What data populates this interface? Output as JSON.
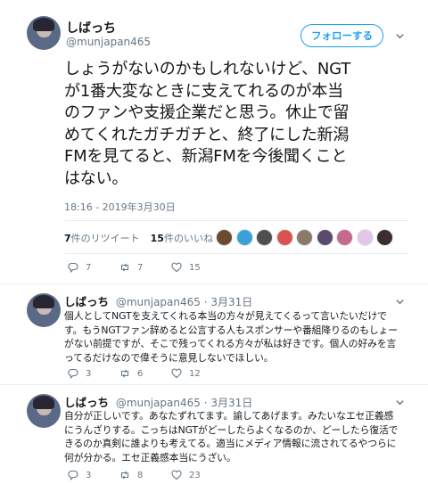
{
  "tweet": {
    "name": "しばっち",
    "handle": "@munjapan465",
    "follow_label": "フォローする",
    "text_lines": [
      "しょうがないのかもしれないけど、NGT",
      "が1番大変なときに支えてれるのが本当",
      "のファンや支援企業だと思う。休止で留",
      "めてくれたガチガチと、終了にした新潟",
      "FMを見てると、新潟FMを今後聞くこと",
      "はない。"
    ],
    "timestamp": "18:16 - 2019年3月30日",
    "retweets_count": "7",
    "retweets_label": "件のリツイート",
    "likes_count": "15",
    "likes_label": "件のいいね",
    "liker_avatar_colors": [
      "#6b4a2f",
      "#3aa0d8",
      "#4f4f4f",
      "#d9534f",
      "#8a7a6a",
      "#5b4a6e",
      "#c46a8a",
      "#e2c6e8",
      "#3a2f2f"
    ],
    "actions": {
      "replies": "7",
      "retweets": "7",
      "likes": "15"
    }
  },
  "replies": [
    {
      "name": "しばっち",
      "handle": "@munjapan465",
      "date": "3月31日",
      "text_lines": [
        "個人としてNGTを支えてくれる本当の方々が見えてくるって言いたいだけで",
        "す。もうNGTファン辞めると公言する人もスポンサーや番組降りるのもしょー",
        "がない前提ですが、そこで残ってくれる方々が私は好きです。個人の好みを言",
        "ってるだけなので偉そうに意見しないでほしい。"
      ],
      "actions": {
        "replies": "3",
        "retweets": "6",
        "likes": "12"
      }
    },
    {
      "name": "しばっち",
      "handle": "@munjapan465",
      "date": "3月31日",
      "text_lines": [
        "自分が正しいです。あなたずれてます。諭してあげます。みたいなエセ正義感",
        "にうんざりする。こっちはNGTがどーしたらよくなるのか、どーしたら復活で",
        "きるのか真剣に誰よりも考えてる。適当にメディア情報に流されてるやつらに",
        "何が分かる。エセ正義感本当にうざい。"
      ],
      "actions": {
        "replies": "3",
        "retweets": "8",
        "likes": "23"
      }
    }
  ]
}
